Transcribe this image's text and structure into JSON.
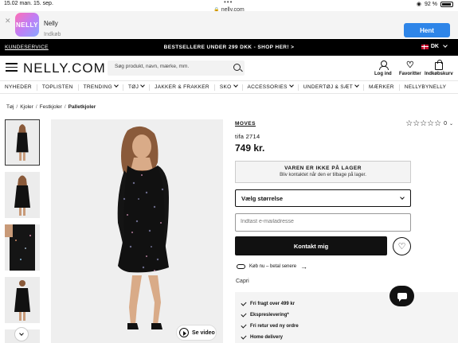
{
  "status": {
    "time": "15.02",
    "date": "man. 15. sep.",
    "battery": "92 %",
    "dots": "•••"
  },
  "browser": {
    "url": "nelly.com"
  },
  "app_banner": {
    "logo_text": "NELLY",
    "name": "Nelly",
    "subtitle": "Indkøb",
    "get_label": "Hent"
  },
  "promo": {
    "customer_service": "KUNDESERVICE",
    "message": "BESTSELLERE UNDER 299 DKK - SHOP HER! >",
    "language": "DK"
  },
  "header": {
    "logo": "NELLY.COM",
    "search_placeholder": "Søg produkt, navn, mærke, mm.",
    "login_label": "Log ind",
    "favorites_label": "Favoritter",
    "cart_label": "Indkøbskurv"
  },
  "nav": [
    {
      "label": "NYHEDER",
      "dropdown": false
    },
    {
      "label": "TOPLISTEN",
      "dropdown": false
    },
    {
      "label": "TRENDING",
      "dropdown": true
    },
    {
      "label": "TØJ",
      "dropdown": true
    },
    {
      "label": "JAKKER & FRAKKER",
      "dropdown": false
    },
    {
      "label": "SKO",
      "dropdown": true
    },
    {
      "label": "ACCESSORIES",
      "dropdown": true
    },
    {
      "label": "UNDERTØJ & SÆT",
      "dropdown": true
    },
    {
      "label": "MÆRKER",
      "dropdown": false
    },
    {
      "label": "NELLYBYNELLY",
      "dropdown": false
    }
  ],
  "breadcrumb": [
    "Tøj",
    "Kjoler",
    "Festkjoler",
    "Palletkjoler"
  ],
  "product": {
    "brand": "MOVES",
    "name": "tifa 2714",
    "price": "749 kr.",
    "rating_count": "0",
    "stars": "☆☆☆☆☆",
    "video_label": "Se video",
    "oos_title": "VAREN ER IKKE PÅ LAGER",
    "oos_subtitle": "Bliv kontaktet når den er tilbage på lager.",
    "size_label": "Vælg størrelse",
    "email_placeholder": "Indtast e-mailadresse",
    "contact_label": "Kontakt mig",
    "klarna_label": "Køb nu – betal senere",
    "color": "Capri",
    "benefits": [
      "Fri fragt over 499 kr",
      "Ekspreslevering*",
      "Fri retur ved ny ordre",
      "Home delivery"
    ]
  },
  "colors": {
    "banner_button": "#2e85e8",
    "dress": "#111111",
    "background": "#efefef"
  },
  "icons": {
    "close": "close-icon",
    "menu": "menu-icon",
    "search": "search-icon",
    "user": "user-icon",
    "heart": "heart-icon",
    "bag": "bag-icon",
    "play": "play-icon",
    "chat": "chat-icon",
    "check": "check-icon"
  }
}
